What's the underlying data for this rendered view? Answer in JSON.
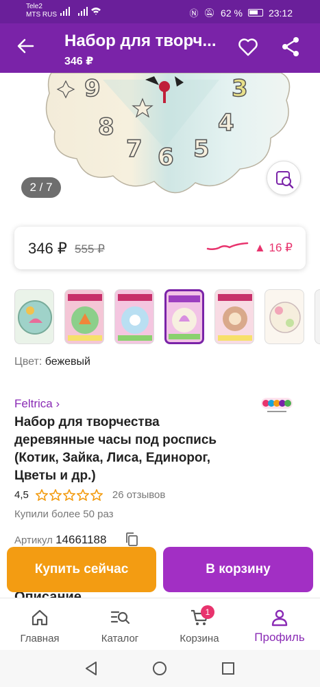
{
  "status_bar": {
    "carrier_1": "Tele2",
    "carrier_2": "MTS RUS",
    "battery_percent": "62 %",
    "time": "23:12"
  },
  "app_bar": {
    "title": "Набор для творч...",
    "price": "346 ₽"
  },
  "gallery": {
    "counter": "2 / 7",
    "clock_numbers": [
      "9",
      "3",
      "8",
      "4",
      "7",
      "6",
      "5"
    ]
  },
  "price_card": {
    "price": "346 ₽",
    "old_price": "555 ₽",
    "delta": "▲ 16 ₽",
    "accent_color": "#e8336d"
  },
  "color": {
    "label": "Цвет:",
    "value": "бежевый"
  },
  "product": {
    "brand": "Feltrica ›",
    "title": "Набор для творчества деревянные часы под роспись (Котик, Зайка, Лиса, Единорог, Цветы и др.)",
    "rating": "4,5",
    "reviews": "26 отзывов",
    "bought": "Купили более 50 раз",
    "article_label": "Артикул",
    "article_number": "14661188",
    "description_heading": "Описание"
  },
  "actions": {
    "buy_now": "Купить сейчас",
    "add_to_cart": "В корзину"
  },
  "bottom_nav": {
    "items": [
      {
        "label": "Главная",
        "icon": "home-icon"
      },
      {
        "label": "Каталог",
        "icon": "catalog-search-icon"
      },
      {
        "label": "Корзина",
        "icon": "cart-icon",
        "badge": "1"
      },
      {
        "label": "Профиль",
        "icon": "profile-icon",
        "active": true
      }
    ]
  },
  "colors": {
    "brand_purple": "#7a23a8",
    "buy_orange": "#f39c12",
    "cart_purple": "#a22fc4"
  }
}
